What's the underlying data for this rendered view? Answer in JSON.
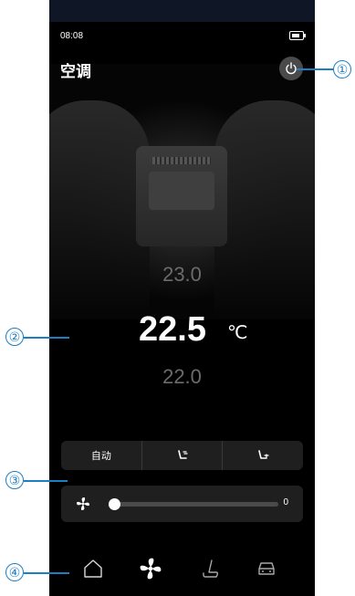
{
  "status_bar": {
    "time": "08:08",
    "battery_icon": "battery-charging-icon"
  },
  "header": {
    "title": "空调",
    "power_icon": "power-icon"
  },
  "temperature": {
    "above": "23.0",
    "current": "22.5",
    "unit": "℃",
    "below": "22.0"
  },
  "modes": [
    {
      "label": "自动",
      "icon": ""
    },
    {
      "label": "",
      "icon": "seat-vent-upper-icon"
    },
    {
      "label": "",
      "icon": "seat-vent-lower-icon"
    }
  ],
  "fan": {
    "icon": "fan-icon",
    "level": 0,
    "value_label": "0"
  },
  "nav": [
    {
      "name": "home",
      "icon": "home-icon"
    },
    {
      "name": "fan",
      "icon": "fan-icon",
      "active": true
    },
    {
      "name": "seat",
      "icon": "seat-icon"
    },
    {
      "name": "car",
      "icon": "car-icon"
    }
  ],
  "callouts": [
    "①",
    "②",
    "③",
    "④"
  ],
  "colors": {
    "background": "#000000",
    "panel": "#1f1f1f",
    "callout": "#1c7ec3",
    "muted_text": "#6b6b6b"
  }
}
